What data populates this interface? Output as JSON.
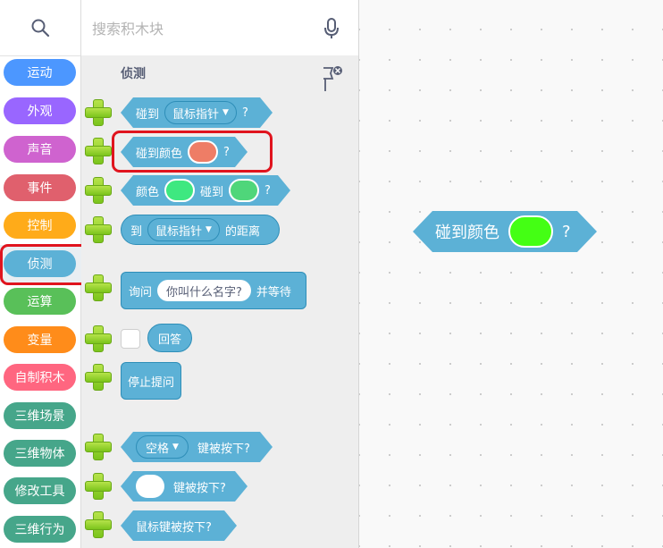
{
  "search": {
    "placeholder": "搜索积木块"
  },
  "categories": [
    {
      "label": "运动",
      "color": "#4c97ff"
    },
    {
      "label": "外观",
      "color": "#9966ff"
    },
    {
      "label": "声音",
      "color": "#cf63cf"
    },
    {
      "label": "事件",
      "color": "#e0606d"
    },
    {
      "label": "控制",
      "color": "#ffab19"
    },
    {
      "label": "侦测",
      "color": "#5cb1d6"
    },
    {
      "label": "运算",
      "color": "#59c059"
    },
    {
      "label": "变量",
      "color": "#ff8c1a"
    },
    {
      "label": "自制积木",
      "color": "#ff6680"
    },
    {
      "label": "三维场景",
      "color": "#46a68a"
    },
    {
      "label": "三维物体",
      "color": "#46a68a"
    },
    {
      "label": "修改工具",
      "color": "#46a68a"
    },
    {
      "label": "三维行为",
      "color": "#46a68a"
    }
  ],
  "palette": {
    "section_title": "侦测",
    "blocks": {
      "touching": {
        "label": "碰到",
        "dropdown": "鼠标指针",
        "suffix": "?"
      },
      "touching_color": {
        "label": "碰到颜色",
        "suffix": "?",
        "color": "#ee7d66"
      },
      "color_touching": {
        "label1": "颜色",
        "color1": "#3ee880",
        "label2": "碰到",
        "color2": "#4fd67a",
        "suffix": "?"
      },
      "distance_to": {
        "label1": "到",
        "dropdown": "鼠标指针",
        "label2": "的距离"
      },
      "ask": {
        "label1": "询问",
        "input": "你叫什么名字?",
        "label2": "并等待"
      },
      "answer": {
        "label": "回答"
      },
      "stop_ask": {
        "label": "停止提问"
      },
      "key_pressed": {
        "dropdown": "空格",
        "label": "键被按下?"
      },
      "key_pressed_input": {
        "label": "键被按下?"
      },
      "mouse_down": {
        "label": "鼠标键被按下?"
      }
    }
  },
  "workspace": {
    "block": {
      "label": "碰到颜色",
      "suffix": "?",
      "color": "#44ff14"
    }
  },
  "colors": {
    "sensing": "#5cb1d6",
    "highlight": "#e0141e",
    "add": "#8ccf24"
  }
}
